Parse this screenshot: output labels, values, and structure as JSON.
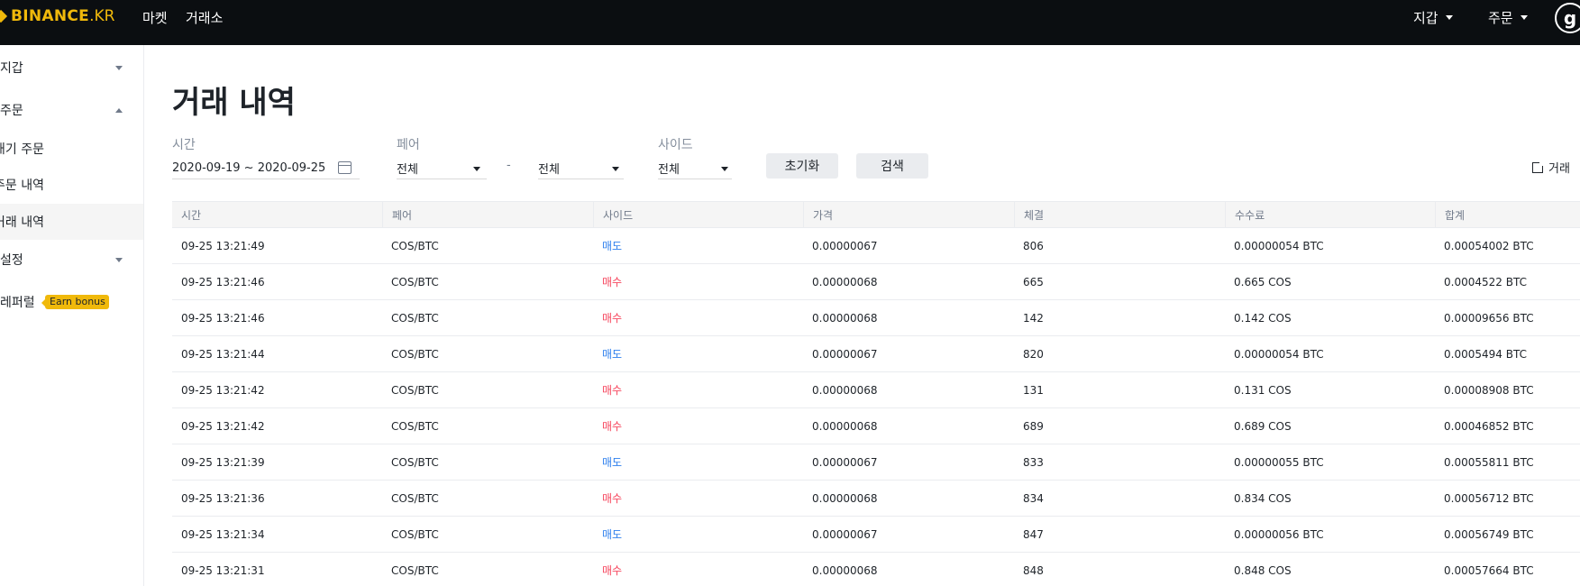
{
  "topbar": {
    "logo": "BINANCE",
    "logo_suffix": ".KR",
    "nav": [
      "마켓",
      "거래소"
    ],
    "right_nav": [
      "지갑",
      "주문"
    ],
    "avatar_letter": "g"
  },
  "sidebar": {
    "items": [
      {
        "label": "지갑"
      },
      {
        "label": "주문"
      },
      {
        "label": "대기 주문"
      },
      {
        "label": "주문 내역"
      },
      {
        "label": "거래 내역"
      },
      {
        "label": "설정"
      },
      {
        "label": "레퍼럴",
        "badge": "Earn bonus"
      }
    ]
  },
  "page": {
    "title": "거래 내역"
  },
  "filters": {
    "time_label": "시간",
    "time_value": "2020-09-19 ~ 2020-09-25",
    "pair_label": "페어",
    "pair_base": "전체",
    "pair_dash": "-",
    "pair_quote": "전체",
    "side_label": "사이드",
    "side_value": "전체",
    "reset_button": "초기화",
    "search_button": "검색",
    "export_label": "거래"
  },
  "table": {
    "headers": [
      "시간",
      "페어",
      "사이드",
      "가격",
      "체결",
      "수수료",
      "합계"
    ],
    "rows": [
      {
        "time": "09-25 13:21:49",
        "pair": "COS/BTC",
        "side": "매도",
        "type": "sell",
        "price": "0.00000067",
        "filled": "806",
        "fee": "0.00000054 BTC",
        "total": "0.00054002 BTC"
      },
      {
        "time": "09-25 13:21:46",
        "pair": "COS/BTC",
        "side": "매수",
        "type": "buy",
        "price": "0.00000068",
        "filled": "665",
        "fee": "0.665 COS",
        "total": "0.0004522 BTC"
      },
      {
        "time": "09-25 13:21:46",
        "pair": "COS/BTC",
        "side": "매수",
        "type": "buy",
        "price": "0.00000068",
        "filled": "142",
        "fee": "0.142 COS",
        "total": "0.00009656 BTC"
      },
      {
        "time": "09-25 13:21:44",
        "pair": "COS/BTC",
        "side": "매도",
        "type": "sell",
        "price": "0.00000067",
        "filled": "820",
        "fee": "0.00000054 BTC",
        "total": "0.0005494 BTC"
      },
      {
        "time": "09-25 13:21:42",
        "pair": "COS/BTC",
        "side": "매수",
        "type": "buy",
        "price": "0.00000068",
        "filled": "131",
        "fee": "0.131 COS",
        "total": "0.00008908 BTC"
      },
      {
        "time": "09-25 13:21:42",
        "pair": "COS/BTC",
        "side": "매수",
        "type": "buy",
        "price": "0.00000068",
        "filled": "689",
        "fee": "0.689 COS",
        "total": "0.00046852 BTC"
      },
      {
        "time": "09-25 13:21:39",
        "pair": "COS/BTC",
        "side": "매도",
        "type": "sell",
        "price": "0.00000067",
        "filled": "833",
        "fee": "0.00000055 BTC",
        "total": "0.00055811 BTC"
      },
      {
        "time": "09-25 13:21:36",
        "pair": "COS/BTC",
        "side": "매수",
        "type": "buy",
        "price": "0.00000068",
        "filled": "834",
        "fee": "0.834 COS",
        "total": "0.00056712 BTC"
      },
      {
        "time": "09-25 13:21:34",
        "pair": "COS/BTC",
        "side": "매도",
        "type": "sell",
        "price": "0.00000067",
        "filled": "847",
        "fee": "0.00000056 BTC",
        "total": "0.00056749 BTC"
      },
      {
        "time": "09-25 13:21:31",
        "pair": "COS/BTC",
        "side": "매수",
        "type": "buy",
        "price": "0.00000068",
        "filled": "848",
        "fee": "0.848 COS",
        "total": "0.00057664 BTC"
      }
    ]
  },
  "colors": {
    "topbar_bg": "#0b0e11",
    "brand": "#f0b90b",
    "sell": "#2f80ed",
    "buy": "#f6465d"
  }
}
